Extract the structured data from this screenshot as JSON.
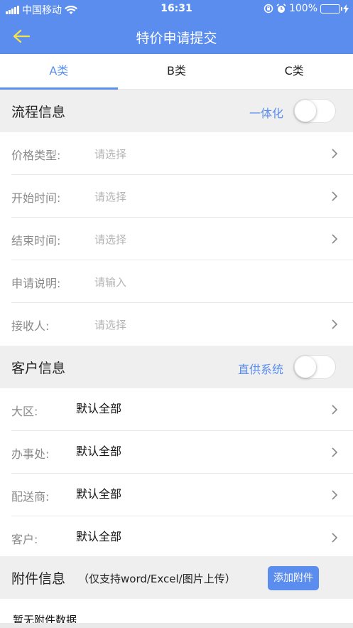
{
  "status_bar": {
    "carrier": "中国移动",
    "time": "16:31",
    "battery": "100%"
  },
  "nav": {
    "title": "特价申请提交",
    "back_icon": "back-arrow-icon"
  },
  "tabs": [
    {
      "label": "A类",
      "active": true
    },
    {
      "label": "B类",
      "active": false
    },
    {
      "label": "C类",
      "active": false
    }
  ],
  "process_section": {
    "title": "流程信息",
    "toggle_label": "一体化",
    "toggle_on": false
  },
  "process_rows": [
    {
      "label": "价格类型:",
      "value": "请选择"
    },
    {
      "label": "开始时间:",
      "value": "请选择"
    },
    {
      "label": "结束时间:",
      "value": "请选择"
    },
    {
      "label": "申请说明:",
      "value": "请输入"
    },
    {
      "label": "接收人:",
      "value": "请选择"
    }
  ],
  "customer_section": {
    "title": "客户信息",
    "toggle_label": "直供系统",
    "toggle_on": false
  },
  "customer_rows": [
    {
      "label": "大区:",
      "value": "默认全部"
    },
    {
      "label": "办事处:",
      "value": "默认全部"
    },
    {
      "label": "配送商:",
      "value": "默认全部"
    },
    {
      "label": "客户:",
      "value": "默认全部"
    }
  ],
  "attachment_section": {
    "title": "附件信息",
    "note": "（仅支持word/Excel/图片上传）",
    "button_label": "添加附件",
    "empty_text": "暂无附件数据"
  },
  "colors": {
    "accent": "#5b8def",
    "section_bg": "#efefef",
    "toggle_accent_text": "#5b8def"
  }
}
